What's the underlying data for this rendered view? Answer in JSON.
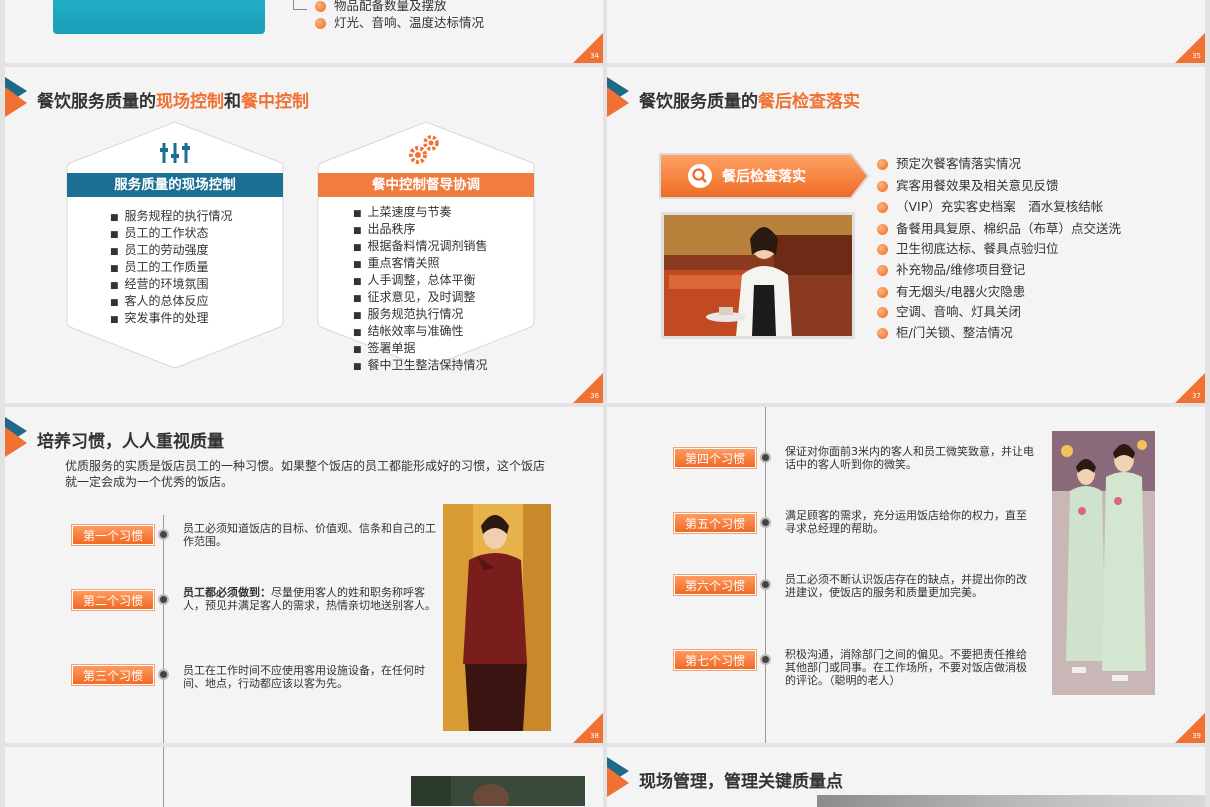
{
  "slide34": {
    "items": [
      "物品配备数量及摆放",
      "灯光、音响、温度达标情况"
    ],
    "page": "34"
  },
  "slide35": {
    "page": "35"
  },
  "slide36": {
    "title_pre": "餐饮服务质量的",
    "title_hl1": "现场控制",
    "title_mid": "和",
    "title_hl2": "餐中控制",
    "panel1": {
      "icon": "sliders-icon",
      "header": "服务质量的现场控制",
      "items": [
        "服务规程的执行情况",
        "员工的工作状态",
        "员工的劳动强度",
        "员工的工作质量",
        "经营的环境氛围",
        "客人的总体反应",
        "突发事件的处理"
      ]
    },
    "panel2": {
      "icon": "gears-icon",
      "header": "餐中控制督导协调",
      "items": [
        "上菜速度与节奏",
        "出品秩序",
        "根据备料情况调剂销售",
        "重点客情关照",
        "人手调整，总体平衡",
        "征求意见，及时调整",
        "服务规范执行情况",
        "结帐效率与准确性",
        "签署单据",
        "餐中卫生整洁保持情况"
      ]
    },
    "page": "36"
  },
  "slide37": {
    "title_pre": "餐饮服务质量的",
    "title_hl": "餐后检查落实",
    "button": "餐后检查落实",
    "icon": "search-icon",
    "items": [
      "预定次餐客情落实情况",
      "宾客用餐效果及相关意见反馈",
      "（VIP）充实客史档案　酒水复核结帐",
      "备餐用具复原、棉织品（布草）点交送洗",
      "卫生彻底达标、餐具点验归位",
      "补充物品/维修项目登记",
      "有无烟头/电器火灾隐患",
      "空调、音响、灯具关闭",
      "柜/门关锁、整洁情况"
    ],
    "page": "37"
  },
  "slide38": {
    "title": "培养习惯，人人重视质量",
    "intro": "优质服务的实质是饭店员工的一种习惯。如果整个饭店的员工都能形成好的习惯，这个饭店就一定会成为一个优秀的饭店。",
    "habits": [
      {
        "tag": "第一个习惯",
        "bold": "",
        "text": "员工必须知道饭店的目标、价值观、信条和自己的工作范围。"
      },
      {
        "tag": "第二个习惯",
        "bold": "员工都必须做到：",
        "text": "尽量使用客人的姓和职务称呼客人，预见并满足客人的需求，热情亲切地送别客人。"
      },
      {
        "tag": "第三个习惯",
        "bold": "",
        "text": "员工在工作时间不应使用客用设施设备，在任何时间、地点，行动都应该以客为先。"
      }
    ],
    "page": "38"
  },
  "slide39": {
    "habits": [
      {
        "tag": "第四个习惯",
        "text": "保证对你面前3米内的客人和员工微笑致意，并让电话中的客人听到你的微笑。"
      },
      {
        "tag": "第五个习惯",
        "text": "满足顾客的需求，充分运用饭店给你的权力，直至寻求总经理的帮助。"
      },
      {
        "tag": "第六个习惯",
        "text": "员工必须不断认识饭店存在的缺点，并提出你的改进建议，使饭店的服务和质量更加完美。"
      },
      {
        "tag": "第七个习惯",
        "text": "积极沟通，消除部门之间的偏见。不要把责任推给其他部门或同事。在工作场所，不要对饭店做消极的评论。（聪明的老人）"
      }
    ],
    "page": "39"
  },
  "slide41": {
    "title": "现场管理，管理关键质量点"
  },
  "colors": {
    "accent": "#f07132",
    "teal": "#1a9fb8",
    "navy": "#1f6a8a"
  }
}
